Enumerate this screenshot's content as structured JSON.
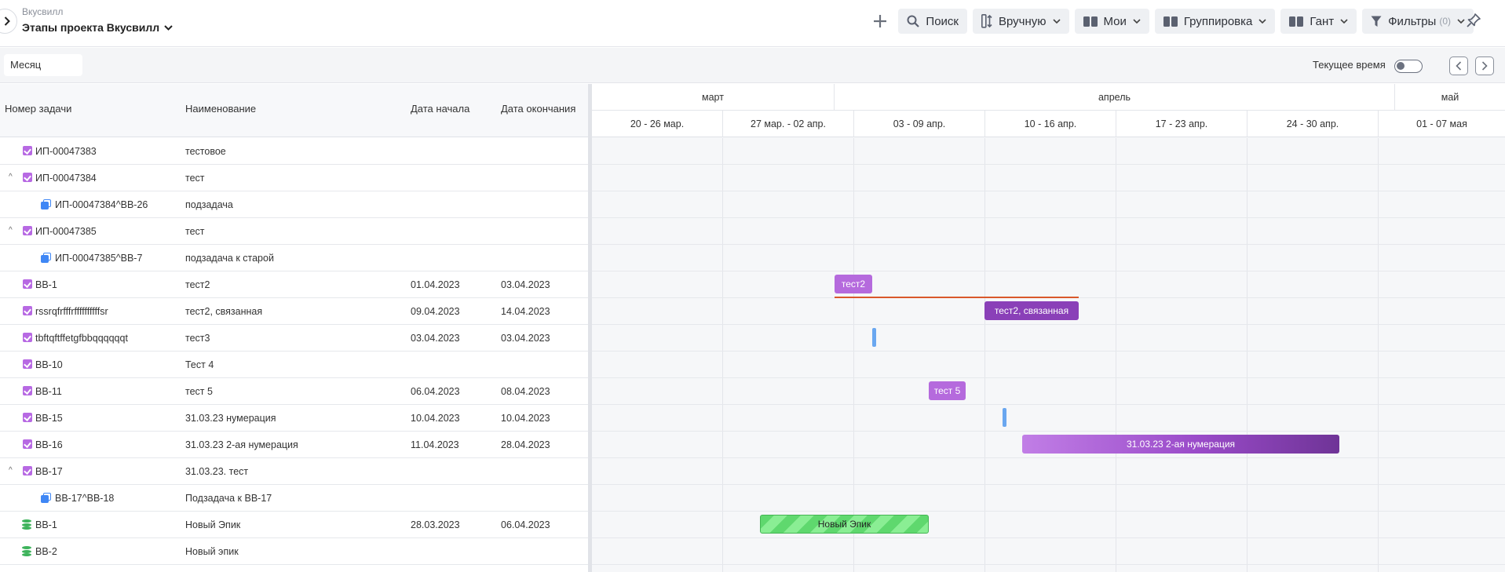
{
  "header": {
    "breadcrumb": "Вкусвилл",
    "project_title": "Этапы проекта Вкусвилл",
    "toolbar": {
      "search": "Поиск",
      "sort": "Вручную",
      "mine": "Мои",
      "grouping": "Группировка",
      "view": "Гант",
      "filters": "Фильтры",
      "filters_count": "(0)"
    }
  },
  "subbar": {
    "scale": "Месяц",
    "current_time_label": "Текущее время"
  },
  "table": {
    "columns": {
      "number": "Номер задачи",
      "name": "Наименование",
      "start": "Дата начала",
      "end": "Дата окончания"
    },
    "rows": [
      {
        "type": "task",
        "expandable": false,
        "number": "ИП-00047383",
        "name": "тестовое",
        "start": "",
        "end": ""
      },
      {
        "type": "task",
        "expandable": true,
        "number": "ИП-00047384",
        "name": "тест",
        "start": "",
        "end": ""
      },
      {
        "type": "subtask",
        "expandable": false,
        "number": "ИП-00047384^ВВ-26",
        "name": "подзадача",
        "start": "",
        "end": ""
      },
      {
        "type": "task",
        "expandable": true,
        "number": "ИП-00047385",
        "name": "тест",
        "start": "",
        "end": ""
      },
      {
        "type": "subtask",
        "expandable": false,
        "number": "ИП-00047385^ВВ-7",
        "name": "подзадача к старой",
        "start": "",
        "end": ""
      },
      {
        "type": "task",
        "expandable": false,
        "number": "ВВ-1",
        "name": "тест2",
        "start": "01.04.2023",
        "end": "03.04.2023"
      },
      {
        "type": "task",
        "expandable": false,
        "number": "rssrqfrfffrffffffffffsr",
        "name": "тест2, связанная",
        "start": "09.04.2023",
        "end": "14.04.2023"
      },
      {
        "type": "task",
        "expandable": false,
        "number": "tbftqftffetgfbbqqqqqqt",
        "name": "тест3",
        "start": "03.04.2023",
        "end": "03.04.2023"
      },
      {
        "type": "task",
        "expandable": false,
        "number": "ВВ-10",
        "name": "Тест 4",
        "start": "",
        "end": ""
      },
      {
        "type": "task",
        "expandable": false,
        "number": "ВВ-11",
        "name": "тест 5",
        "start": "06.04.2023",
        "end": "08.04.2023"
      },
      {
        "type": "task",
        "expandable": false,
        "number": "ВВ-15",
        "name": "31.03.23 нумерация",
        "start": "10.04.2023",
        "end": "10.04.2023"
      },
      {
        "type": "task",
        "expandable": false,
        "number": "ВВ-16",
        "name": "31.03.23 2-ая нумерация",
        "start": "11.04.2023",
        "end": "28.04.2023"
      },
      {
        "type": "task",
        "expandable": true,
        "number": "ВВ-17",
        "name": "31.03.23. тест",
        "start": "",
        "end": ""
      },
      {
        "type": "subtask",
        "expandable": false,
        "number": "ВВ-17^ВВ-18",
        "name": "Подзадача к ВВ-17",
        "start": "",
        "end": ""
      },
      {
        "type": "epic",
        "expandable": false,
        "number": "ВВ-1",
        "name": "Новый Эпик",
        "start": "28.03.2023",
        "end": "06.04.2023"
      },
      {
        "type": "epic",
        "expandable": false,
        "number": "ВВ-2",
        "name": "Новый эпик",
        "start": "",
        "end": ""
      }
    ]
  },
  "gantt": {
    "months": [
      "март",
      "апрель",
      "май"
    ],
    "weeks": [
      "20 - 26 мар.",
      "27 мар. - 02 апр.",
      "03 - 09 апр.",
      "10 - 16 апр.",
      "17 - 23 апр.",
      "24 - 30 апр.",
      "01 - 07 мая"
    ],
    "bars": {
      "b5": "тест2",
      "b6": "тест2, связанная",
      "b9": "тест 5",
      "b11": "31.03.23 2-ая нумерация",
      "b14": "Новый Эпик"
    }
  },
  "colors": {
    "task": "#b56add",
    "milestone": "#6aa7f0",
    "epic": "#5fd86e",
    "dependency": "#d9582b",
    "subtask_icon": "#3f87f5"
  }
}
